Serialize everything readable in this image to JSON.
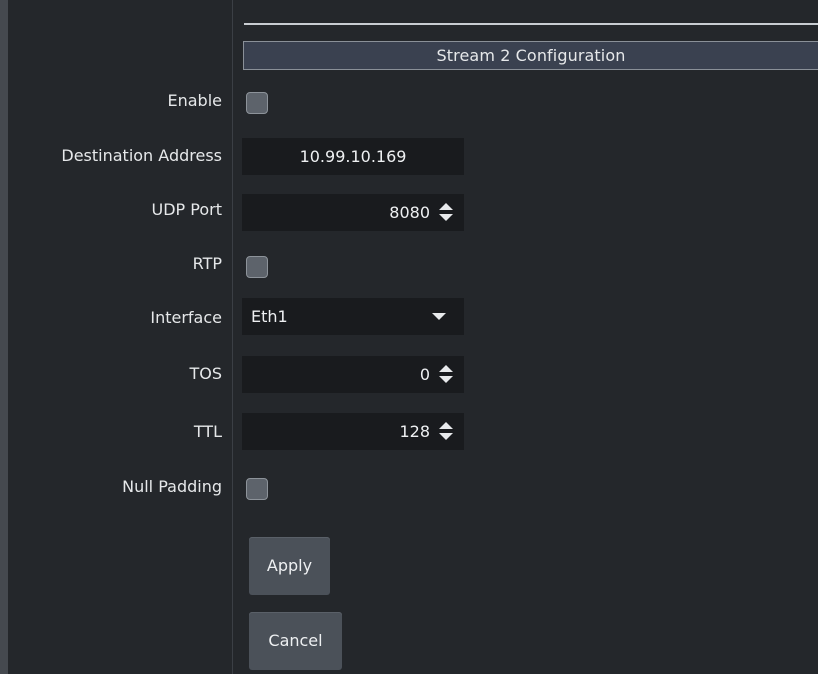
{
  "panel": {
    "title": "Stream 2 Configuration"
  },
  "fields": {
    "enable": {
      "label": "Enable",
      "checked": false
    },
    "destination_address": {
      "label": "Destination Address",
      "value": "10.99.10.169"
    },
    "udp_port": {
      "label": "UDP Port",
      "value": "8080"
    },
    "rtp": {
      "label": "RTP",
      "checked": false
    },
    "interface": {
      "label": "Interface",
      "value": "Eth1"
    },
    "tos": {
      "label": "TOS",
      "value": "0"
    },
    "ttl": {
      "label": "TTL",
      "value": "128"
    },
    "null_padding": {
      "label": "Null Padding",
      "checked": false
    }
  },
  "actions": {
    "apply_label": "Apply",
    "cancel_label": "Cancel"
  },
  "icons": {
    "spinner": "up-down-arrows-icon",
    "dropdown": "caret-down-icon"
  },
  "colors": {
    "background": "#24272b",
    "section_header": "#3a4150",
    "input_background": "#191b1e",
    "checkbox": "#5d636b",
    "button": "#4b5159"
  }
}
